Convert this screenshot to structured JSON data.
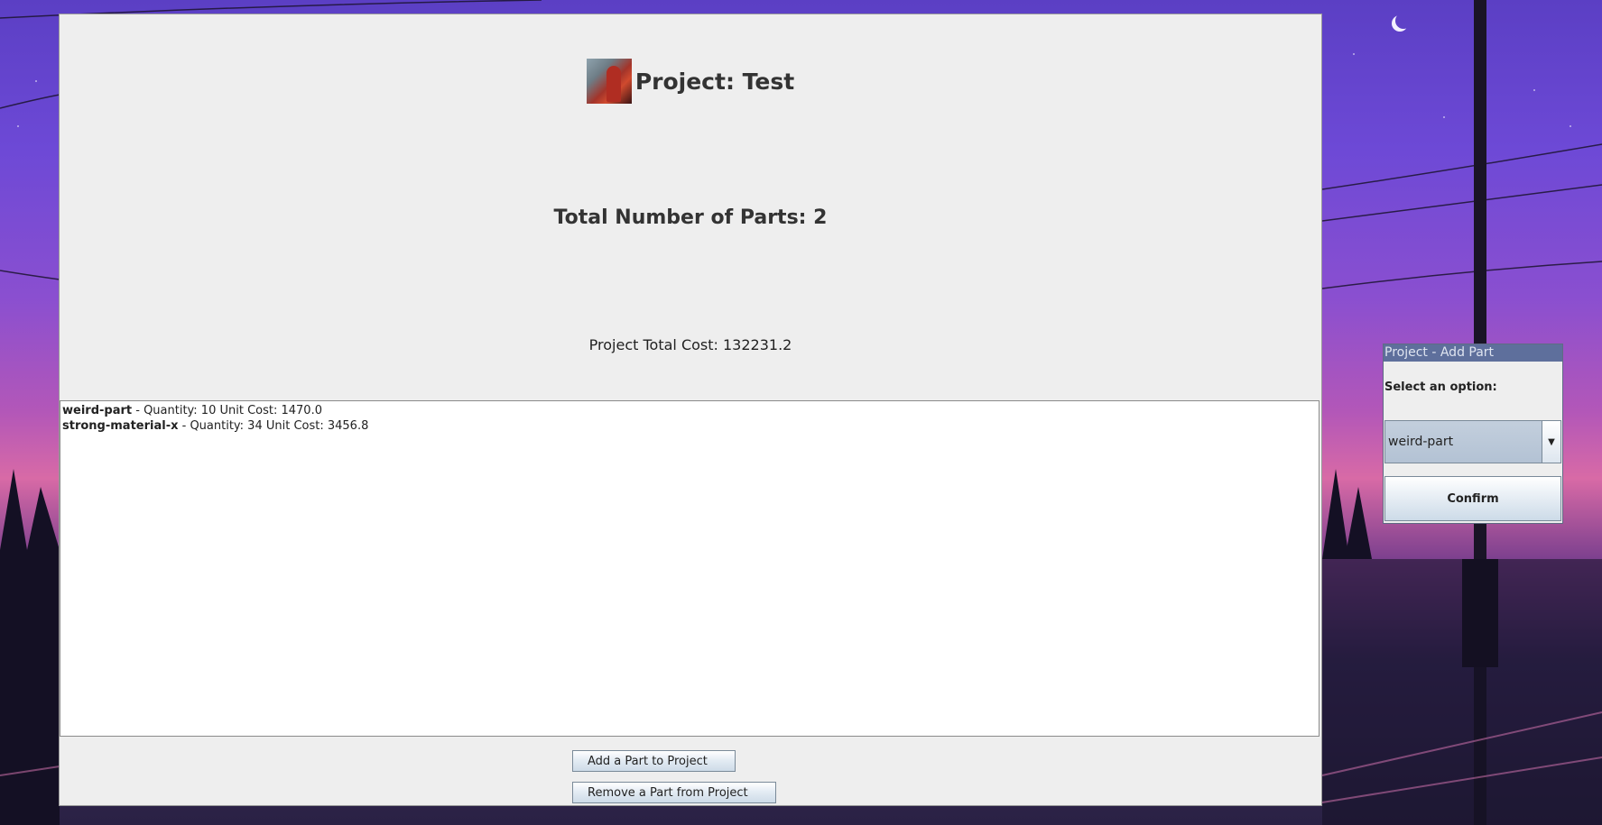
{
  "main_window": {
    "title": "Project: Test",
    "parts_count_label": "Total Number of Parts: 2",
    "total_cost_label": "Project Total Cost: 132231.2",
    "parts": [
      {
        "name": "weird-part",
        "details": " - Quantity: 10 Unit Cost: 1470.0"
      },
      {
        "name": "strong-material-x",
        "details": " - Quantity: 34 Unit Cost: 3456.8"
      }
    ],
    "buttons": {
      "add": "Add a Part to Project",
      "remove": "Remove a Part from Project"
    }
  },
  "dialog": {
    "title": "Project - Add Part",
    "prompt": "Select an option:",
    "selected_option": "weird-part",
    "confirm_label": "Confirm"
  },
  "icons": {
    "dropdown": "chevron-down-icon",
    "moon": "moon-icon"
  }
}
